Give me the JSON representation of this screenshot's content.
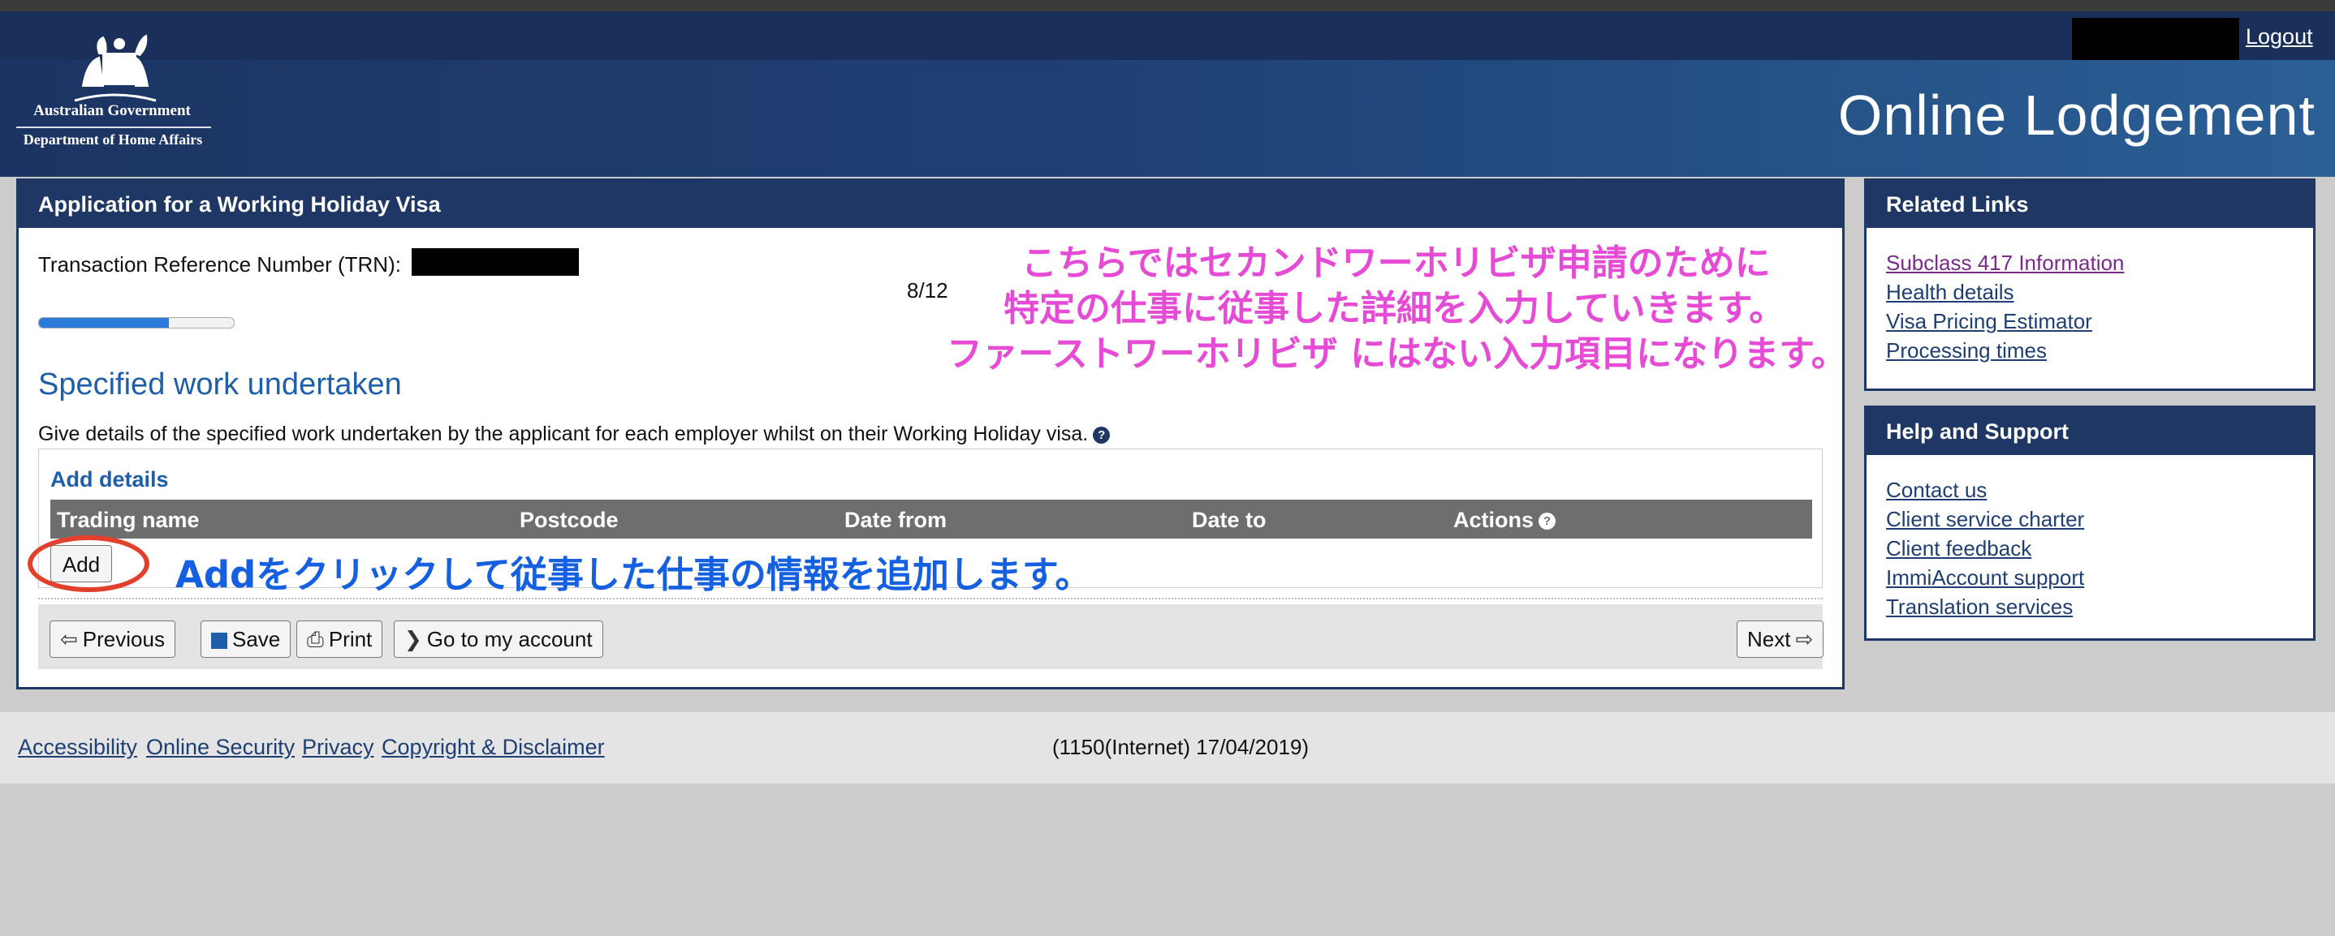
{
  "header": {
    "gov_line1": "Australian Government",
    "gov_line2": "Department of Home Affairs",
    "logout": "Logout",
    "app_title": "Online Lodgement"
  },
  "main": {
    "panel_title": "Application for a Working Holiday Visa",
    "trn_label": "Transaction Reference Number (TRN):",
    "page_count": "8/12",
    "progress_fraction": 0.667,
    "section_title": "Specified work undertaken",
    "description": "Give details of the specified work undertaken by the applicant for each employer whilst on their Working Holiday visa.",
    "add_details_title": "Add details",
    "table_headers": [
      "Trading name",
      "Postcode",
      "Date from",
      "Date to",
      "Actions"
    ],
    "add_button": "Add",
    "nav": {
      "previous": "Previous",
      "save": "Save",
      "print": "Print",
      "go_account": "Go to my account",
      "next": "Next"
    }
  },
  "related_links": {
    "title": "Related Links",
    "items": [
      "Subclass 417 Information",
      "Health details",
      "Visa Pricing Estimator",
      "Processing times"
    ]
  },
  "help_support": {
    "title": "Help and Support",
    "items": [
      "Contact us",
      "Client service charter",
      "Client feedback",
      "ImmiAccount support",
      "Translation services"
    ]
  },
  "footer": {
    "links": [
      "Accessibility",
      "Online Security",
      "Privacy",
      "Copyright & Disclaimer"
    ],
    "version": "(1150(Internet) 17/04/2019)"
  },
  "annotations": {
    "pink_lines": [
      "こちらではセカンドワーホリビザ申請のために",
      "特定の仕事に従事した詳細を入力していきます。",
      "ファーストワーホリビザ にはない入力項目になります。"
    ],
    "blue_note": "Addをクリックして従事した仕事の情報を追加します。"
  },
  "colors": {
    "header_dark": "#1f3765",
    "accent_blue": "#1f5ea8",
    "annotation_pink": "#e64bd6",
    "annotation_blue": "#1560e0",
    "highlight_red": "#e2402c"
  }
}
